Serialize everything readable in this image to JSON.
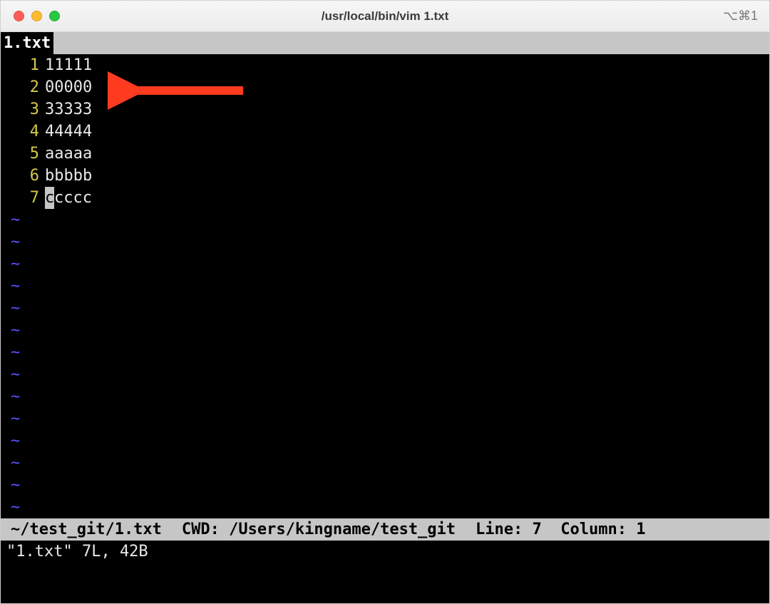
{
  "window": {
    "title": "/usr/local/bin/vim 1.txt",
    "hotkey": "⌥⌘1"
  },
  "tab": {
    "label": "1.txt"
  },
  "file": {
    "lines": [
      {
        "n": "1",
        "text": "11111"
      },
      {
        "n": "2",
        "text": "00000"
      },
      {
        "n": "3",
        "text": "33333"
      },
      {
        "n": "4",
        "text": "44444"
      },
      {
        "n": "5",
        "text": "aaaaa"
      },
      {
        "n": "6",
        "text": "bbbbb"
      },
      {
        "n": "7",
        "cursor_char": "c",
        "rest": "cccc"
      }
    ]
  },
  "tilde": "~",
  "status": {
    "path": "~/test_git/1.txt",
    "cwd_label": "CWD:",
    "cwd": "/Users/kingname/test_git",
    "line_label": "Line:",
    "line": "7",
    "col_label": "Column:",
    "col": "1"
  },
  "cmdline": "\"1.txt\" 7L, 42B",
  "annotation": {
    "arrow_points_to_line": 2
  }
}
